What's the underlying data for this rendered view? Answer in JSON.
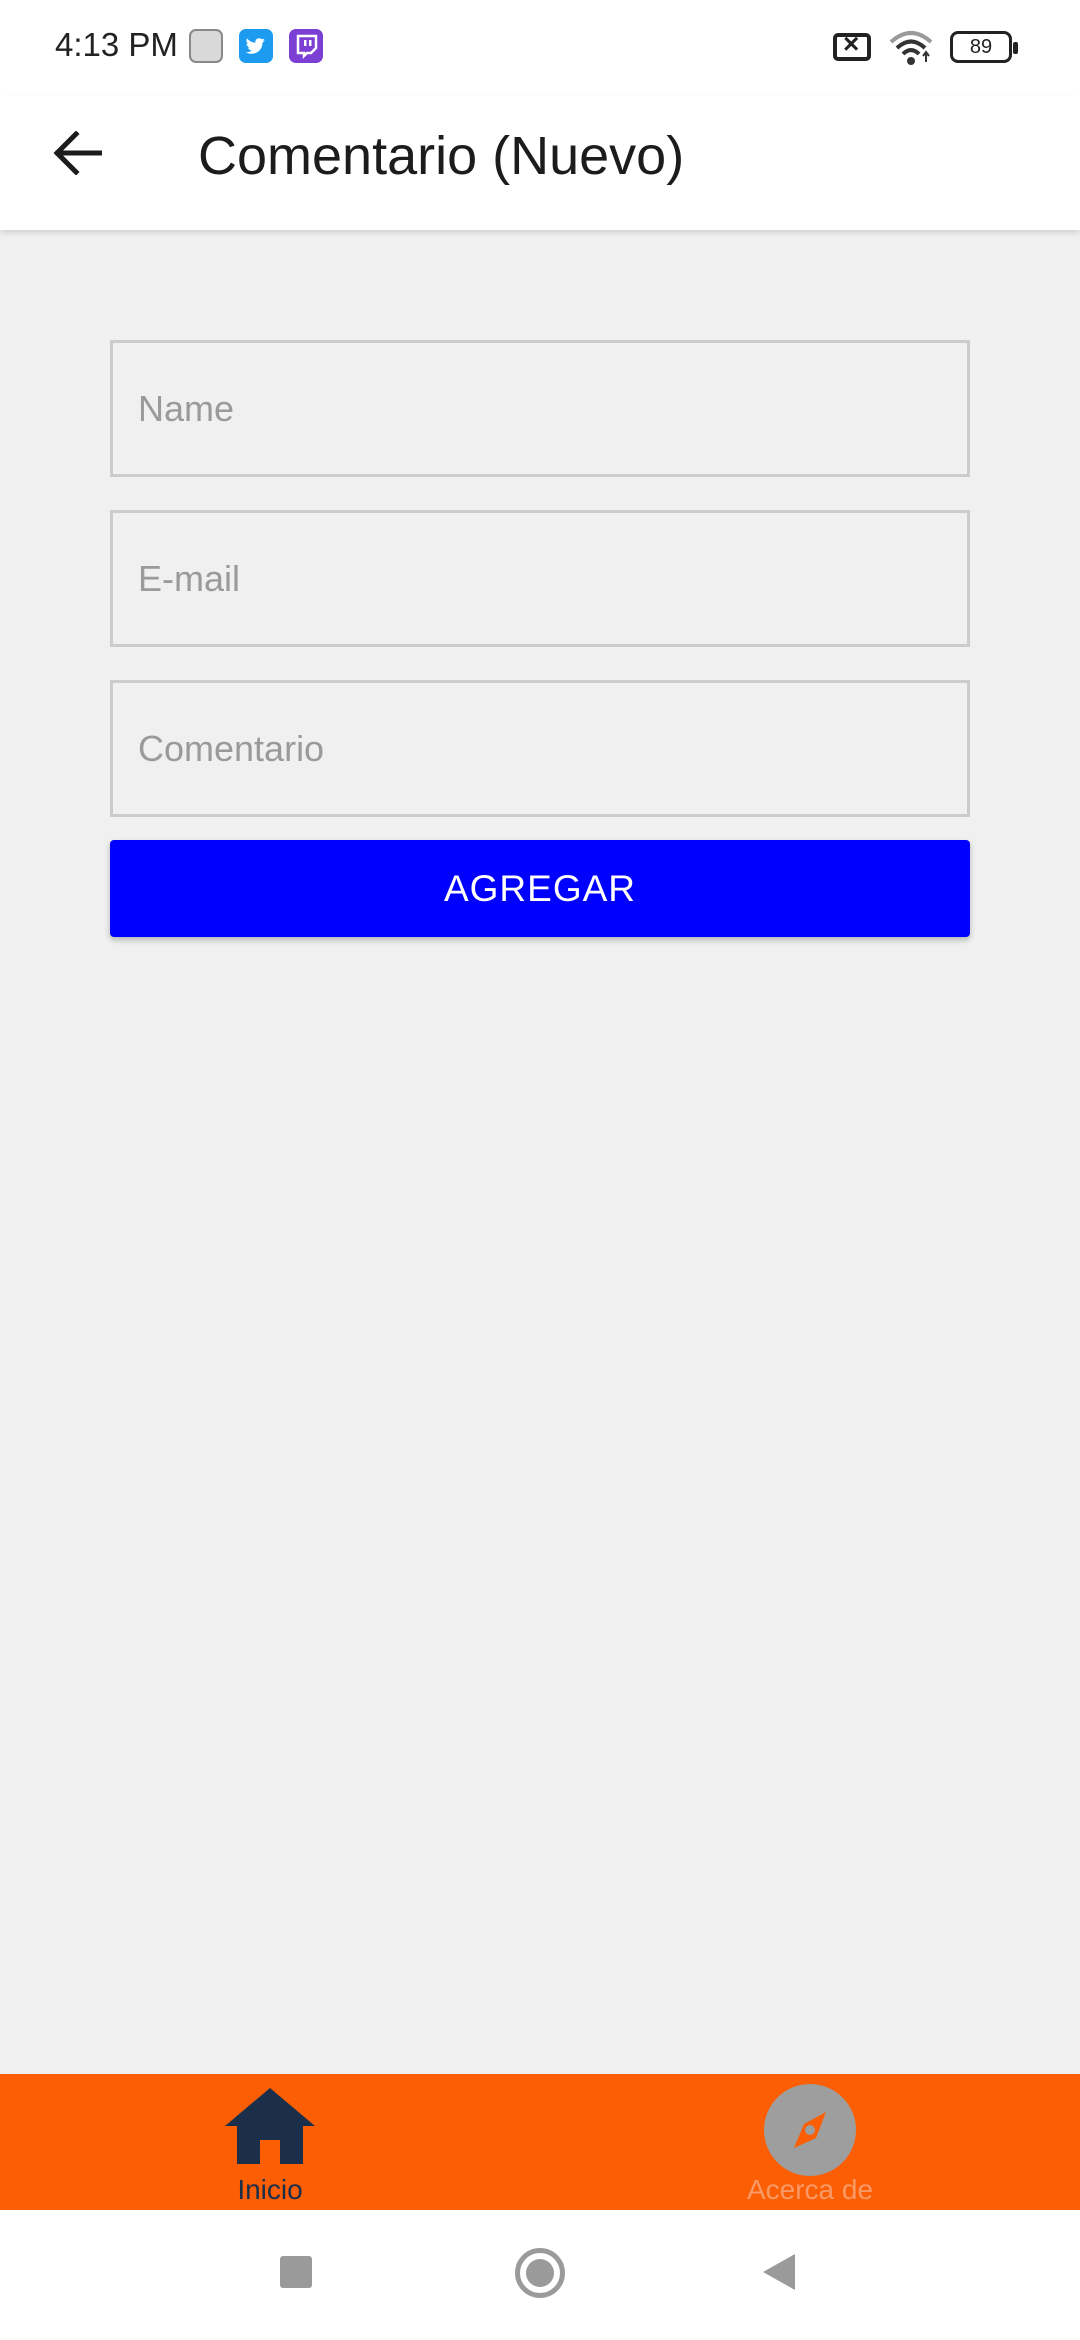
{
  "status_bar": {
    "time": "4:13 PM",
    "notification_icons": [
      "app-icon",
      "twitter-icon",
      "twitch-icon"
    ],
    "battery_level": "89"
  },
  "app_bar": {
    "title": "Comentario (Nuevo)"
  },
  "form": {
    "name_placeholder": "Name",
    "email_placeholder": "E-mail",
    "comment_placeholder": "Comentario",
    "submit_label": "AGREGAR"
  },
  "bottom_nav": {
    "items": [
      {
        "label": "Inicio",
        "icon": "home-icon",
        "active": true
      },
      {
        "label": "Acerca de",
        "icon": "compass-icon",
        "active": false
      }
    ]
  },
  "colors": {
    "accent_button": "#0000ff",
    "bottom_nav_bg": "#fc5e03",
    "active_nav": "#1b2f4b",
    "page_bg": "#f0f0f0"
  }
}
